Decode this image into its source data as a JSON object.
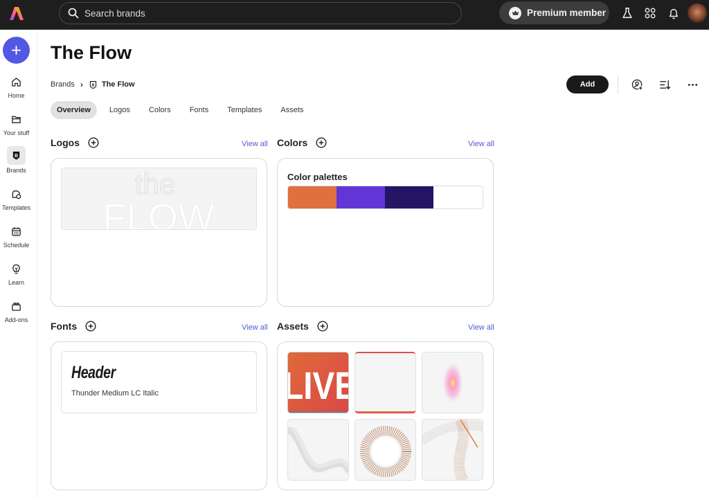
{
  "topbar": {
    "search_placeholder": "Search brands",
    "premium_label": "Premium member",
    "icons": [
      "labs-icon",
      "apps-grid-icon",
      "notifications-bell-icon",
      "user-avatar"
    ]
  },
  "rail": {
    "create_label": "+",
    "items": [
      {
        "label": "Home",
        "icon": "home-icon"
      },
      {
        "label": "Your stuff",
        "icon": "folder-icon"
      },
      {
        "label": "Brands",
        "icon": "brand-icon",
        "active": true
      },
      {
        "label": "Templates",
        "icon": "templates-icon"
      },
      {
        "label": "Schedule",
        "icon": "calendar-icon"
      },
      {
        "label": "Learn",
        "icon": "lightbulb-icon"
      },
      {
        "label": "Add-ons",
        "icon": "addons-icon"
      }
    ]
  },
  "page": {
    "title": "The Flow",
    "breadcrumb": {
      "root": "Brands",
      "current": "The Flow"
    },
    "actions": {
      "add_label": "Add",
      "share_icon": "share-user-icon",
      "sort_icon": "sort-icon",
      "more_icon": "more-icon"
    },
    "tabs": [
      {
        "label": "Overview",
        "active": true
      },
      {
        "label": "Logos"
      },
      {
        "label": "Colors"
      },
      {
        "label": "Fonts"
      },
      {
        "label": "Templates"
      },
      {
        "label": "Assets"
      }
    ]
  },
  "sections": {
    "logos": {
      "title": "Logos",
      "view_all": "View all",
      "logo_text_top": "the",
      "logo_text_bottom": "FLOW"
    },
    "colors": {
      "title": "Colors",
      "view_all": "View all",
      "palette_title": "Color palettes",
      "swatches": [
        "#df7040",
        "#6235d6",
        "#241565",
        "#ffffff"
      ]
    },
    "fonts": {
      "title": "Fonts",
      "view_all": "View all",
      "sample": "Header",
      "font_name": "Thunder Medium LC Italic"
    },
    "assets": {
      "title": "Assets",
      "view_all": "View all",
      "items": [
        {
          "name": "live-graphic",
          "text": "LIVE"
        },
        {
          "name": "red-frame-graphic"
        },
        {
          "name": "glow-graphic"
        },
        {
          "name": "wave-graphic"
        },
        {
          "name": "ring-graphic"
        },
        {
          "name": "ribbon-graphic"
        }
      ]
    }
  }
}
